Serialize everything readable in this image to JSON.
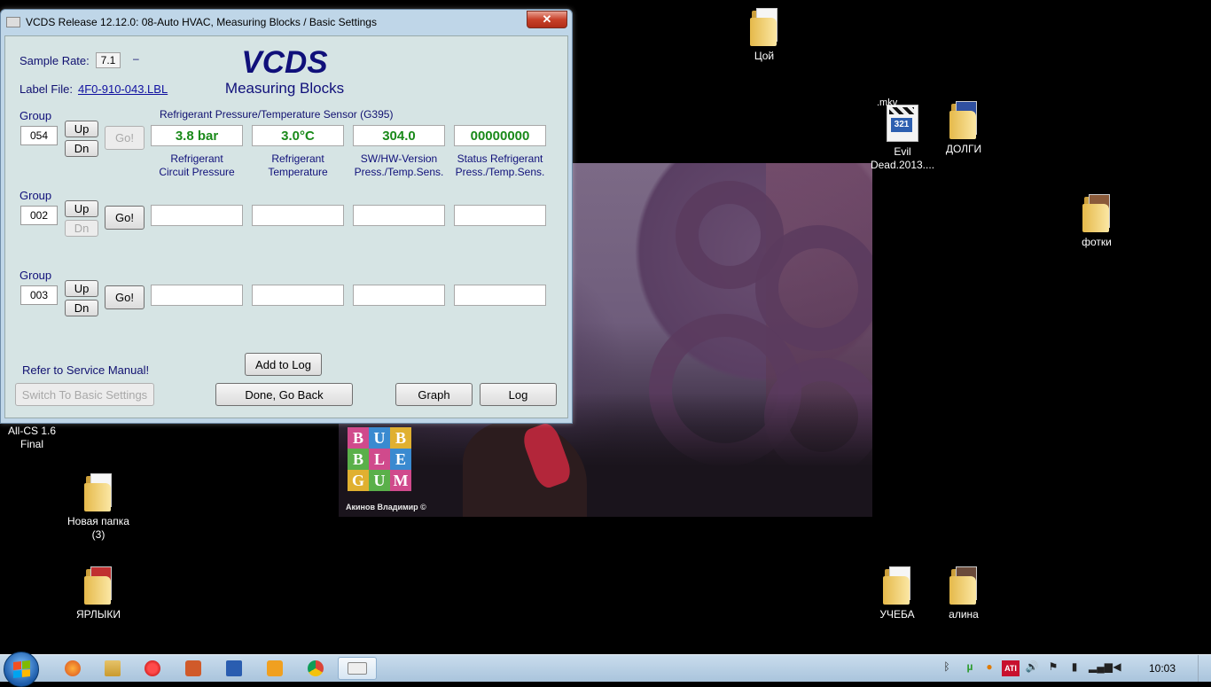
{
  "window": {
    "title": "VCDS Release 12.12.0: 08-Auto HVAC,  Measuring Blocks / Basic Settings",
    "close_glyph": "✕"
  },
  "header": {
    "sample_rate_label": "Sample Rate:",
    "sample_rate_value": "7.1",
    "sample_rate_suffix": "–",
    "label_file_label": "Label File:",
    "label_file_value": "4F0-910-043.LBL",
    "app_name": "VCDS",
    "mode_title": "Measuring Blocks"
  },
  "groups": [
    {
      "label": "Group",
      "number": "054",
      "up": "Up",
      "dn": "Dn",
      "go": "Go!",
      "description": "Refrigerant Pressure/Temperature Sensor (G395)",
      "fields": [
        "3.8 bar",
        "3.0°C",
        "304.0",
        "00000000"
      ],
      "captions": [
        [
          "Refrigerant",
          "Circuit Pressure"
        ],
        [
          "Refrigerant",
          "Temperature"
        ],
        [
          "SW/HW-Version",
          "Press./Temp.Sens."
        ],
        [
          "Status Refrigerant",
          "Press./Temp.Sens."
        ]
      ]
    },
    {
      "label": "Group",
      "number": "002",
      "up": "Up",
      "dn": "Dn",
      "go": "Go!"
    },
    {
      "label": "Group",
      "number": "003",
      "up": "Up",
      "dn": "Dn",
      "go": "Go!"
    }
  ],
  "footer": {
    "refer_text": "Refer to Service Manual!",
    "switch_button": "Switch To Basic Settings",
    "add_to_log": "Add to Log",
    "done_button": "Done, Go Back",
    "graph_button": "Graph",
    "log_button": "Log"
  },
  "desktop_icons": {
    "tsoy": "Цой",
    "mkv_tag": ".mkv",
    "evil_dead": "Evil Dead.2013....",
    "dolgi": "ДОЛГИ",
    "fotki": "фотки",
    "allcs": "All-CS 1.6 Final",
    "novaya": "Новая папка (3)",
    "yarlyki": "ЯРЛЫКИ",
    "ucheba": "УЧЕБА",
    "alina": "алина",
    "media_number": "321"
  },
  "wallpaper": {
    "bubble_letters": [
      "B",
      "U",
      "B",
      "B",
      "L",
      "E",
      "G",
      "U",
      "M"
    ],
    "credit": "Акинов Владимир ©"
  },
  "taskbar": {
    "clock": "10:03",
    "tray_ati": "ATI"
  }
}
